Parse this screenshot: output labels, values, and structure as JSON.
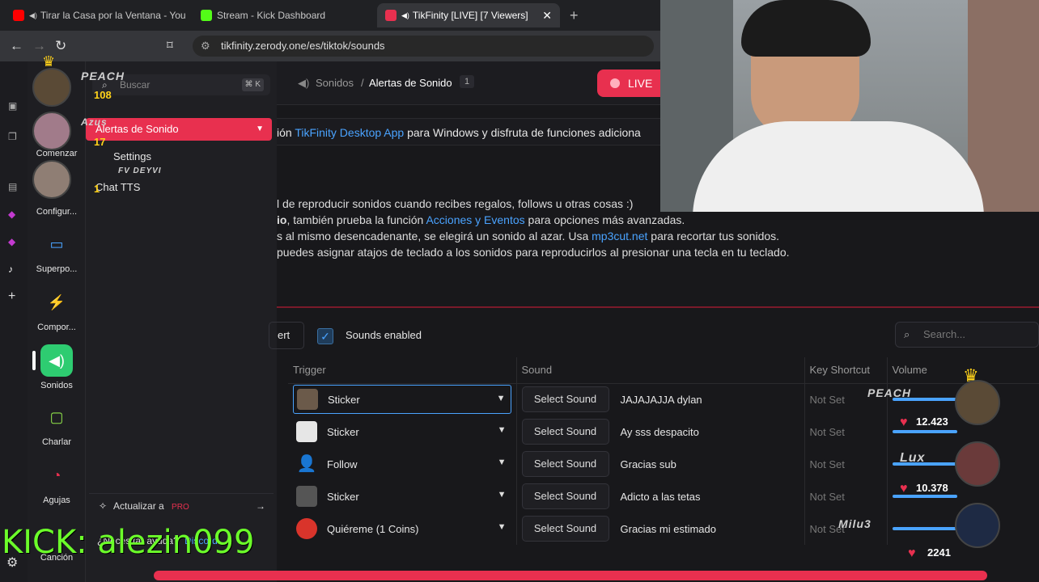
{
  "browser": {
    "tabs": [
      {
        "title": "Tirar la Casa por la Ventana - You",
        "color": "#ff0000"
      },
      {
        "title": "Stream - Kick Dashboard",
        "color": "#53fc18"
      },
      {
        "title": "TikFinity [LIVE] [7 Viewers]",
        "color": "#e8304f"
      }
    ],
    "url": "tikfinity.zerody.one/es/tiktok/sounds"
  },
  "nav": {
    "items": [
      {
        "label": "Comenzar",
        "icon": "rocket-icon"
      },
      {
        "label": "Configur...",
        "icon": "gear-icon"
      },
      {
        "label": "Superpo...",
        "icon": "monitor-icon"
      },
      {
        "label": "Compor...",
        "icon": "bolt-icon"
      },
      {
        "label": "Sonidos",
        "icon": "speaker-icon"
      },
      {
        "label": "Charlar",
        "icon": "chat-icon"
      },
      {
        "label": "Agujas",
        "icon": "gauge-icon"
      },
      {
        "label": "Canción",
        "icon": "music-icon"
      }
    ]
  },
  "panel": {
    "search_placeholder": "Buscar",
    "search_kbd": "⌘ K",
    "selected": "Alertas de Sonido",
    "sub_items": [
      "Settings",
      "Chat TTS"
    ],
    "upgrade_label": "Actualizar a",
    "upgrade_badge": "PRO",
    "help_label": "¿Necesitar ayuda?",
    "help_link": "Discord"
  },
  "header": {
    "crumb_parent": "Sonidos",
    "crumb_current": "Alertas de Sonido",
    "crumb_badge": "1",
    "live_label": "LIVE"
  },
  "banner": {
    "pre": "ión ",
    "link": "TikFinity Desktop App",
    "post": " para Windows y disfruta de funciones adiciona"
  },
  "info": {
    "line1": "l de reproducir sonidos cuando recibes regalos, follows u otras cosas :)",
    "line2_pre": "io",
    "line2_mid": ", también prueba la función ",
    "line2_link": "Acciones y Eventos",
    "line2_post": " para opciones más avanzadas.",
    "line3_pre": "s al mismo desencadenante, se elegirá un sonido al azar. Usa ",
    "line3_link": "mp3cut.net",
    "line3_post": " para recortar tus sonidos.",
    "line4": " puedes asignar atajos de teclado a los sonidos para reproducirlos al presionar una tecla en tu teclado."
  },
  "toolbar": {
    "insert_fragment": "ert",
    "sounds_enabled": "Sounds enabled",
    "search_placeholder": "Search..."
  },
  "table": {
    "headers": [
      "Trigger",
      "Sound",
      "Key Shortcut",
      "Volume"
    ],
    "select_label": "Select Sound",
    "rows": [
      {
        "trigger": "Sticker",
        "sound": "JAJAJAJJA dylan",
        "key": "Not Set"
      },
      {
        "trigger": "Sticker",
        "sound": "Ay sss despacito",
        "key": "Not Set"
      },
      {
        "trigger": "Follow",
        "sound": "Gracias sub",
        "key": "Not Set"
      },
      {
        "trigger": "Sticker",
        "sound": "Adicto a las tetas",
        "key": "Not Set"
      },
      {
        "trigger": "Quiéreme (1 Coins)",
        "sound": "Gracias mi estimado",
        "key": "Not Set"
      }
    ]
  },
  "overlay_left": {
    "user1_name": "PEACH",
    "user1_points": "108",
    "user2_name": "Azus",
    "user2_points": "17",
    "user3_name": "FV DEYVI",
    "user3_points": "1"
  },
  "overlay_right": {
    "user1_name": "PEACH",
    "user1_points": "12.423",
    "user2_name": "Lux",
    "user2_points": "10.378",
    "user3_name": "Milu3",
    "user3_points": "2241"
  },
  "kick_text": "KICK: alezin099",
  "colors": {
    "accent": "#e8304f",
    "link": "#4aa3ff",
    "kick": "#6cff2a"
  }
}
